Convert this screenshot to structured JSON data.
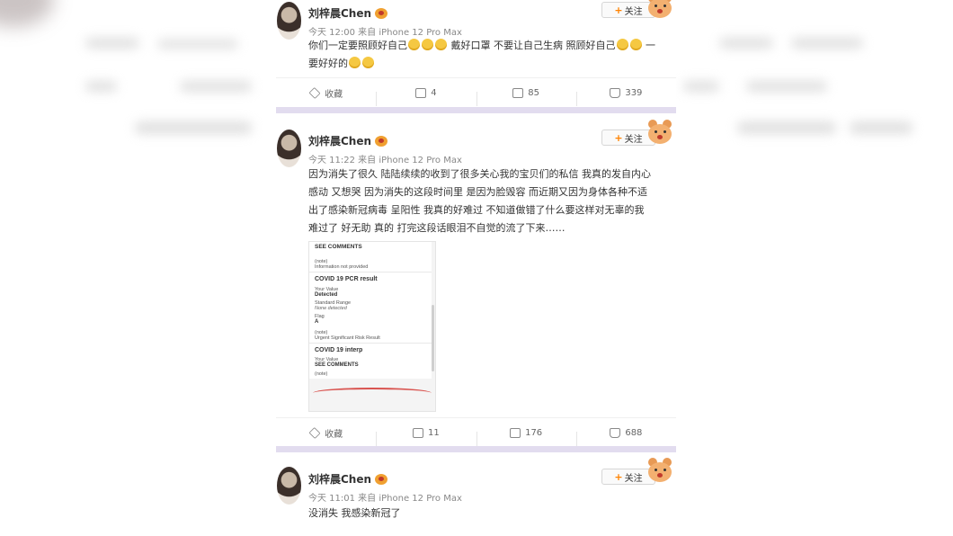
{
  "colors": {
    "accent": "#ff8200",
    "divider": "#e2dcef"
  },
  "posts": [
    {
      "name": "刘梓晨Chen",
      "meta": "今天 12:00 来自 iPhone 12 Pro Max",
      "lines": [
        "你们一定要照顾好自己",
        "戴好口罩 不要让自己生病 照顾好自己",
        "一",
        "要好好的"
      ],
      "follow": "关注",
      "actions": {
        "favorite": "收藏",
        "share": "4",
        "comment": "85",
        "like": "339"
      }
    },
    {
      "name": "刘梓晨Chen",
      "meta": "今天 11:22 来自 iPhone 12 Pro Max",
      "lines": [
        "因为消失了很久 陆陆续续的收到了很多关心我的宝贝们的私信 我真的发自内心",
        "感动 又想哭 因为消失的这段时间里 是因为脸毁容 而近期又因为身体各种不适",
        "出了感染新冠病毒 呈阳性 我真的好难过 不知道做错了什么要这样对无辜的我",
        "难过了 好无助 真的 打完这段话眼泪不自觉的流了下来……"
      ],
      "follow": "关注",
      "image": {
        "c1_title": "SEE COMMENTS",
        "c1_note": "(note)",
        "c1_info": "Information not provided",
        "c2_title": "COVID 19 PCR result",
        "c2_yv": "Your Value",
        "c2_val": "Detected",
        "c2_sr": "Standard Range",
        "c2_none": "None detected",
        "c2_flag": "Flag",
        "c2_a": "A",
        "c2_note": "(note)",
        "c2_urgent": "Urgent Significant Risk Result",
        "c3_title": "COVID 19 interp",
        "c3_yv": "Your Value",
        "c3_val": "SEE COMMENTS",
        "c3_note": "(note)"
      },
      "actions": {
        "favorite": "收藏",
        "share": "11",
        "comment": "176",
        "like": "688"
      }
    },
    {
      "name": "刘梓晨Chen",
      "meta": "今天 11:01 来自 iPhone 12 Pro Max",
      "lines": [
        "没消失 我感染新冠了"
      ],
      "follow": "关注"
    }
  ]
}
